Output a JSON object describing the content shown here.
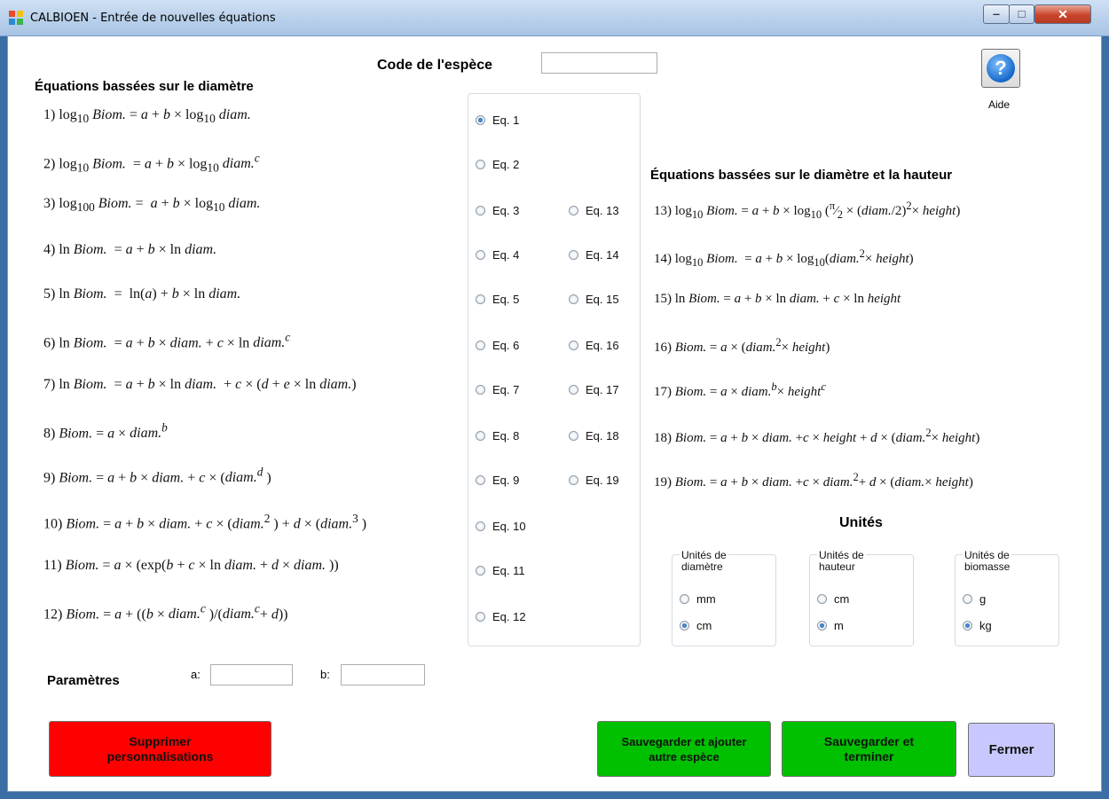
{
  "window": {
    "title": "CALBIOEN - Entrée de nouvelles équations",
    "minimize_glyph": "‒",
    "maximize_glyph": "□",
    "close_glyph": "✕"
  },
  "species": {
    "label": "Code de l'espèce",
    "value": ""
  },
  "help": {
    "glyph": "?",
    "label": "Aide"
  },
  "diameter_section": {
    "title": "Équations bassées sur le diamètre"
  },
  "height_section": {
    "title": "Équations bassées sur le diamètre et la hauteur"
  },
  "radios": [
    {
      "label": "Eq. 1",
      "checked": true
    },
    {
      "label": "Eq. 2",
      "checked": false
    },
    {
      "label": "Eq. 3",
      "checked": false
    },
    {
      "label": "Eq. 4",
      "checked": false
    },
    {
      "label": "Eq. 5",
      "checked": false
    },
    {
      "label": "Eq. 6",
      "checked": false
    },
    {
      "label": "Eq. 7",
      "checked": false
    },
    {
      "label": "Eq. 8",
      "checked": false
    },
    {
      "label": "Eq. 9",
      "checked": false
    },
    {
      "label": "Eq. 10",
      "checked": false
    },
    {
      "label": "Eq. 11",
      "checked": false
    },
    {
      "label": "Eq. 12",
      "checked": false
    },
    {
      "label": "Eq. 13",
      "checked": false
    },
    {
      "label": "Eq. 14",
      "checked": false
    },
    {
      "label": "Eq. 15",
      "checked": false
    },
    {
      "label": "Eq. 16",
      "checked": false
    },
    {
      "label": "Eq. 17",
      "checked": false
    },
    {
      "label": "Eq. 18",
      "checked": false
    },
    {
      "label": "Eq. 19",
      "checked": false
    }
  ],
  "units": {
    "title": "Unités",
    "diameter": {
      "label1": "Unités de",
      "label2": "diamètre",
      "opt1": "mm",
      "opt2": "cm",
      "selected": "cm"
    },
    "height": {
      "label1": "Unités de",
      "label2": "hauteur",
      "opt1": "cm",
      "opt2": "m",
      "selected": "m"
    },
    "biomass": {
      "label1": "Unités de",
      "label2": "biomasse",
      "opt1": "g",
      "opt2": "kg",
      "selected": "kg"
    }
  },
  "params": {
    "label": "Paramètres",
    "a_label": "a:",
    "a_value": "",
    "b_label": "b:",
    "b_value": ""
  },
  "buttons": {
    "delete_line1": "Supprimer",
    "delete_line2": "personnalisations",
    "save_add_line1": "Sauvegarder et ajouter",
    "save_add_line2": "autre espèce",
    "save_finish_line1": "Sauvegarder et",
    "save_finish_line2": "terminer",
    "close": "Fermer"
  },
  "colors": {
    "delete": "#ff0000",
    "save": "#00c000",
    "close": "#c8c8ff"
  }
}
